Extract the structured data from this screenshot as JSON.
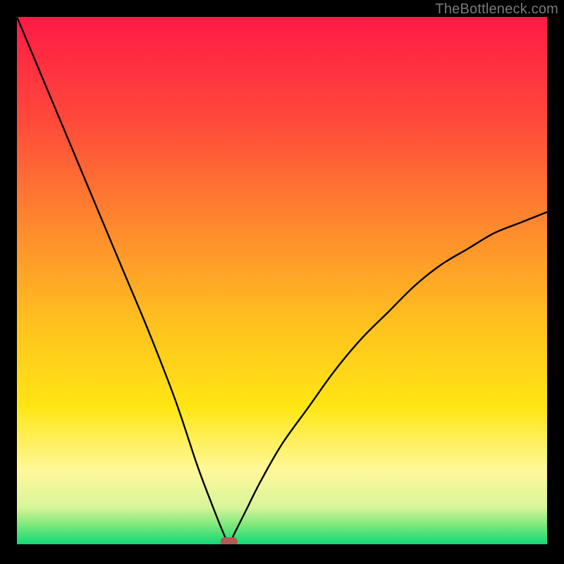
{
  "watermark": "TheBottleneck.com",
  "chart_data": {
    "type": "line",
    "title": "",
    "xlabel": "",
    "ylabel": "",
    "xlim": [
      0,
      100
    ],
    "ylim": [
      0,
      100
    ],
    "grid": false,
    "notes": "Gradient background from red (top) through orange, yellow, pale yellow to green (bottom). A black V-shaped curve descends steeply from the top-left corner to a minimum near x≈40, y≈0, then rises to the right edge reaching roughly y≈63 at x=100. A small red-brown rounded marker sits at the curve minimum.",
    "series": [
      {
        "name": "curve",
        "x": [
          0,
          5,
          10,
          15,
          20,
          25,
          30,
          34,
          37,
          39,
          40,
          41,
          43,
          46,
          50,
          55,
          60,
          65,
          70,
          75,
          80,
          85,
          90,
          95,
          100
        ],
        "y": [
          100,
          88,
          76,
          64,
          52,
          40,
          27,
          15,
          7,
          2,
          0,
          2,
          6,
          12,
          19,
          26,
          33,
          39,
          44,
          49,
          53,
          56,
          59,
          61,
          63
        ]
      }
    ],
    "marker": {
      "x": 40,
      "y": 0,
      "color": "#b45a55"
    },
    "gradient_stops": [
      {
        "offset": 0.0,
        "color": "#ff1a46"
      },
      {
        "offset": 0.2,
        "color": "#ff4a3a"
      },
      {
        "offset": 0.4,
        "color": "#ff8a2e"
      },
      {
        "offset": 0.58,
        "color": "#ffc11f"
      },
      {
        "offset": 0.74,
        "color": "#ffe614"
      },
      {
        "offset": 0.86,
        "color": "#fff89a"
      },
      {
        "offset": 0.93,
        "color": "#d8f59a"
      },
      {
        "offset": 0.965,
        "color": "#79e879"
      },
      {
        "offset": 1.0,
        "color": "#11d977"
      }
    ]
  }
}
